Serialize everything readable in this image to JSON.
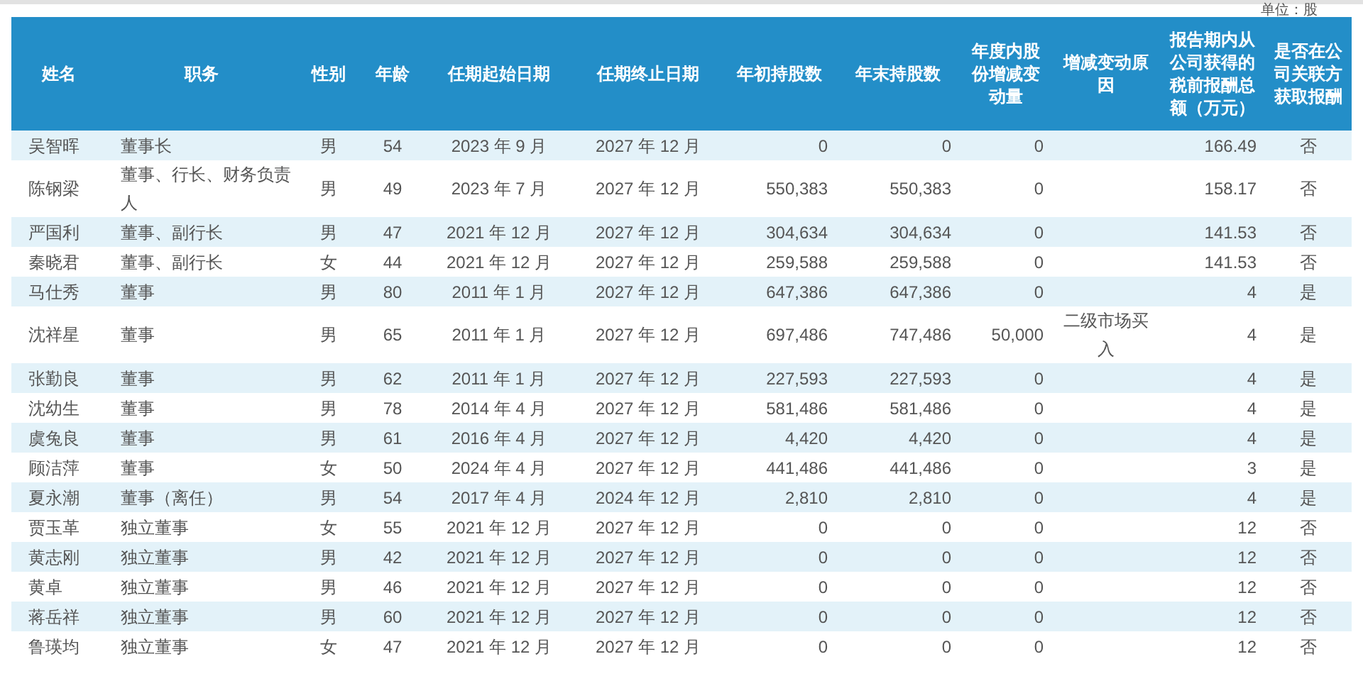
{
  "unit": "单位：股",
  "columns": [
    "姓名",
    "职务",
    "性别",
    "年龄",
    "任期起始日期",
    "任期终止日期",
    "年初持股数",
    "年末持股数",
    "年度内股份增减变动量",
    "增减变动原因",
    "报告期内从公司获得的税前报酬总额（万元）",
    "是否在公司关联方获取报酬"
  ],
  "rows": [
    {
      "name": "吴智晖",
      "position": "董事长",
      "gender": "男",
      "age": "54",
      "start": "2023 年 9 月",
      "end": "2027 年 12 月",
      "shares_begin": "0",
      "shares_end": "0",
      "change": "0",
      "pay": "166.49",
      "related_pay": "否"
    },
    {
      "name": "陈钢梁",
      "position": "董事、行长、财务负责人",
      "gender": "男",
      "age": "49",
      "start": "2023 年 7 月",
      "end": "2027 年 12 月",
      "shares_begin": "550,383",
      "shares_end": "550,383",
      "change": "0",
      "pay": "158.17",
      "related_pay": "否"
    },
    {
      "name": "严国利",
      "position": "董事、副行长",
      "gender": "男",
      "age": "47",
      "start": "2021 年 12 月",
      "end": "2027 年 12 月",
      "shares_begin": "304,634",
      "shares_end": "304,634",
      "change": "0",
      "pay": "141.53",
      "related_pay": "否"
    },
    {
      "name": "秦晓君",
      "position": "董事、副行长",
      "gender": "女",
      "age": "44",
      "start": "2021 年 12 月",
      "end": "2027 年 12 月",
      "shares_begin": "259,588",
      "shares_end": "259,588",
      "change": "0",
      "pay": "141.53",
      "related_pay": "否"
    },
    {
      "name": "马仕秀",
      "position": "董事",
      "gender": "男",
      "age": "80",
      "start": "2011 年 1 月",
      "end": "2027 年 12 月",
      "shares_begin": "647,386",
      "shares_end": "647,386",
      "change": "0",
      "pay": "4",
      "related_pay": "是"
    },
    {
      "name": "沈祥星",
      "position": "董事",
      "gender": "男",
      "age": "65",
      "start": "2011 年 1 月",
      "end": "2027 年 12 月",
      "shares_begin": "697,486",
      "shares_end": "747,486",
      "change": "50,000",
      "reason": "二级市场买入",
      "pay": "4",
      "related_pay": "是"
    },
    {
      "name": "张勤良",
      "position": "董事",
      "gender": "男",
      "age": "62",
      "start": "2011 年 1 月",
      "end": "2027 年 12 月",
      "shares_begin": "227,593",
      "shares_end": "227,593",
      "change": "0",
      "pay": "4",
      "related_pay": "是"
    },
    {
      "name": "沈幼生",
      "position": "董事",
      "gender": "男",
      "age": "78",
      "start": "2014 年 4 月",
      "end": "2027 年 12 月",
      "shares_begin": "581,486",
      "shares_end": "581,486",
      "change": "0",
      "pay": "4",
      "related_pay": "是"
    },
    {
      "name": "虞兔良",
      "position": "董事",
      "gender": "男",
      "age": "61",
      "start": "2016 年 4 月",
      "end": "2027 年 12 月",
      "shares_begin": "4,420",
      "shares_end": "4,420",
      "change": "0",
      "pay": "4",
      "related_pay": "是"
    },
    {
      "name": "顾洁萍",
      "position": "董事",
      "gender": "女",
      "age": "50",
      "start": "2024 年 4 月",
      "end": "2027 年 12 月",
      "shares_begin": "441,486",
      "shares_end": "441,486",
      "change": "0",
      "pay": "3",
      "related_pay": "是"
    },
    {
      "name": "夏永潮",
      "position": "董事（离任）",
      "gender": "男",
      "age": "54",
      "start": "2017 年 4 月",
      "end": "2024 年 12 月",
      "shares_begin": "2,810",
      "shares_end": "2,810",
      "change": "0",
      "pay": "4",
      "related_pay": "是"
    },
    {
      "name": "贾玉革",
      "position": "独立董事",
      "gender": "女",
      "age": "55",
      "start": "2021 年 12 月",
      "end": "2027 年 12 月",
      "shares_begin": "0",
      "shares_end": "0",
      "change": "0",
      "pay": "12",
      "related_pay": "否"
    },
    {
      "name": "黄志刚",
      "position": "独立董事",
      "gender": "男",
      "age": "42",
      "start": "2021 年 12 月",
      "end": "2027 年 12 月",
      "shares_begin": "0",
      "shares_end": "0",
      "change": "0",
      "pay": "12",
      "related_pay": "否"
    },
    {
      "name": "黄卓",
      "position": "独立董事",
      "gender": "男",
      "age": "46",
      "start": "2021 年 12 月",
      "end": "2027 年 12 月",
      "shares_begin": "0",
      "shares_end": "0",
      "change": "0",
      "pay": "12",
      "related_pay": "否"
    },
    {
      "name": "蒋岳祥",
      "position": "独立董事",
      "gender": "男",
      "age": "60",
      "start": "2021 年 12 月",
      "end": "2027 年 12 月",
      "shares_begin": "0",
      "shares_end": "0",
      "change": "0",
      "pay": "12",
      "related_pay": "否"
    },
    {
      "name": "鲁瑛均",
      "position": "独立董事",
      "gender": "女",
      "age": "47",
      "start": "2021 年 12 月",
      "end": "2027 年 12 月",
      "shares_begin": "0",
      "shares_end": "0",
      "change": "0",
      "pay": "12",
      "related_pay": "否"
    }
  ]
}
